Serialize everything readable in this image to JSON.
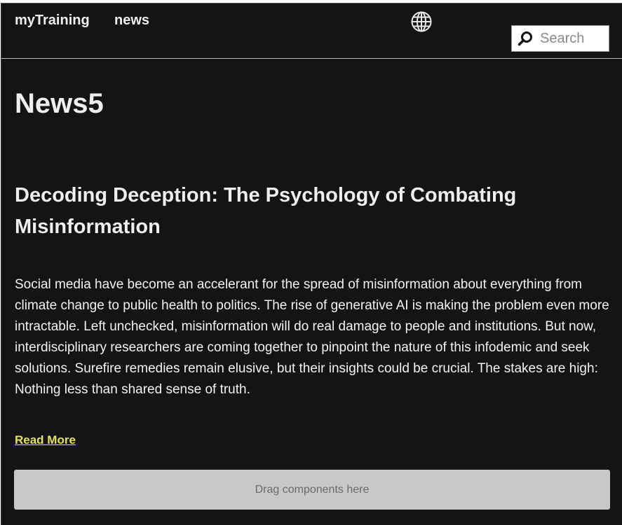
{
  "nav": {
    "items": [
      {
        "label": "myTraining"
      },
      {
        "label": "news"
      }
    ],
    "language_icon": "globe-icon"
  },
  "search": {
    "placeholder": "Search",
    "value": "",
    "icon": "search-icon"
  },
  "main": {
    "page_title": "News5",
    "article": {
      "title": "Decoding Deception: The Psychology of Combating Misinformation",
      "body": "Social media have become an accelerant for the spread of misinformation about everything from climate change to public health to politics. The rise of generative AI is making the problem even more intractable. Left unchecked, misinformation will do real damage to people and institutions. But now, interdisciplinary researchers are coming together to pinpoint the nature of this infodemic and seek solutions. Surefire remedies remain elusive, but their insights could be crucial. The stakes are high: Nothing less than shared sense of truth.",
      "read_more_label": "Read More"
    },
    "dropzone_label": "Drag components here"
  },
  "colors": {
    "background": "#141414",
    "link_accent": "#e7e34a",
    "dropzone": "#c8c8c8"
  }
}
